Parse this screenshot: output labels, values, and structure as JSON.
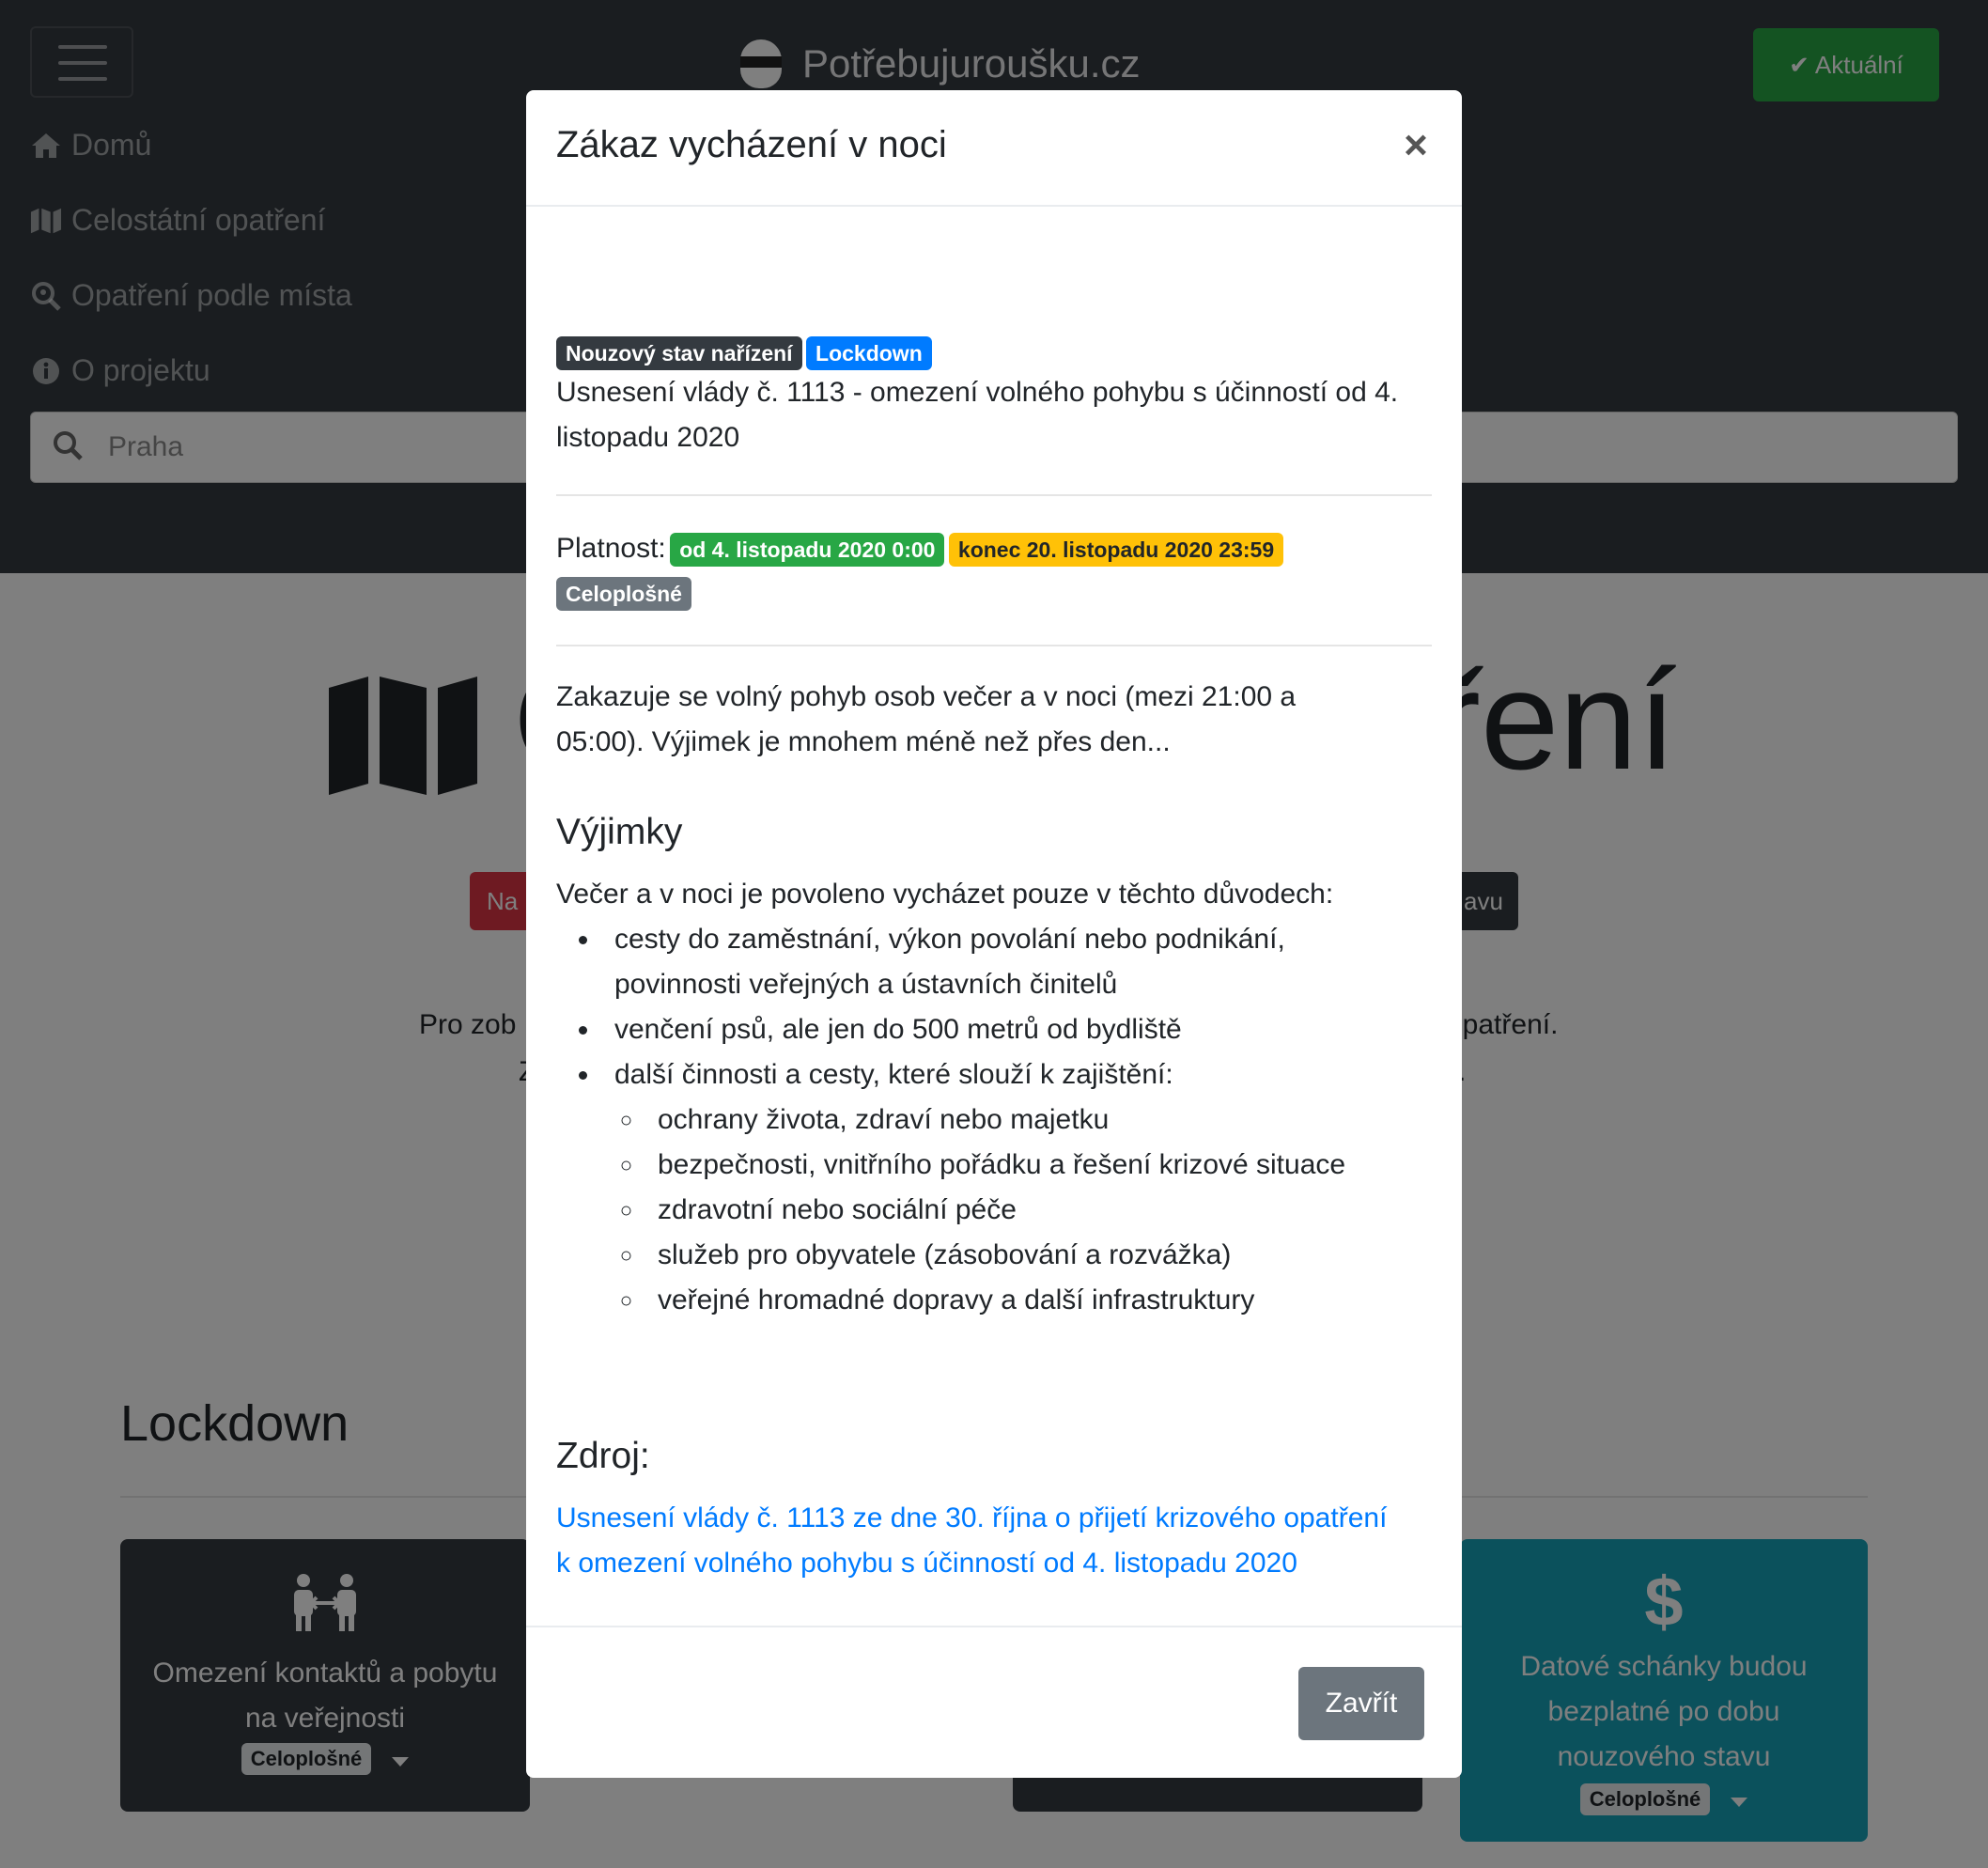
{
  "navbar": {
    "brand": "Potřebujuroušku.cz",
    "status_button": "Aktuální",
    "menu": [
      {
        "label": "Domů",
        "icon": "home-icon"
      },
      {
        "label": "Celostátní opatření",
        "icon": "map-icon"
      },
      {
        "label": "Opatření podle místa",
        "icon": "search-location-icon"
      },
      {
        "label": "O projektu",
        "icon": "info-circle-icon"
      }
    ],
    "search_placeholder": "Praha"
  },
  "background": {
    "heading_left": "C",
    "heading_right": "ření",
    "pill_left": "Na",
    "pill_right": "avu",
    "text_line1_left": "Pro zob",
    "text_line1_right": "opatření.",
    "text_line2_left": "Z",
    "text_line2_right": ".",
    "section_title": "Lockdown",
    "cards": [
      {
        "title": "Omezení kontaktů a pobytu na veřejnosti",
        "badge": "Celoplošné",
        "icon": "people-distance-icon"
      },
      {
        "title": "Datové schánky budou bezplatné po dobu nouzového stavu",
        "badge": "Celoplošné",
        "icon": "dollar-icon"
      }
    ]
  },
  "modal": {
    "title": "Zákaz vycházení v noci",
    "close_symbol": "×",
    "tags": [
      "Nouzový stav nařízení",
      "Lockdown"
    ],
    "summary": "Usnesení vlády č. 1113 - omezení volného pohybu s účinností od 4. listopadu 2020",
    "validity_label": "Platnost:",
    "valid_from": "od 4. listopadu 2020 0:00",
    "valid_to": "konec 20. listopadu 2020 23:59",
    "scope": "Celoplošné",
    "description": "Zakazuje se volný pohyb osob večer a v noci (mezi 21:00 a 05:00). Výjimek je mnohem méně než přes den...",
    "exceptions_heading": "Výjimky",
    "exceptions_intro": "Večer a v noci je povoleno vycházet pouze v těchto důvodech:",
    "exceptions": [
      "cesty do zaměstnání, výkon povolání nebo podnikání, povinnosti veřejných a ústavních činitelů",
      "venčení psů, ale jen do 500 metrů od bydliště",
      "další činnosti a cesty, které slouží k zajištění:"
    ],
    "sub_exceptions": [
      "ochrany života, zdraví nebo majetku",
      "bezpečnosti, vnitřního pořádku a řešení krizové situace",
      "zdravotní nebo sociální péče",
      "služeb pro obyvatele (zásobování a rozvážka)",
      "veřejné hromadné dopravy a další infrastruktury"
    ],
    "source_heading": "Zdroj:",
    "source_link": "Usnesení vlády č. 1113 ze dne 30. října o přijetí krizového opatření k omezení volného pohybu s účinností od 4. listopadu 2020",
    "close_button": "Zavřít"
  },
  "colors": {
    "navbar_bg": "#343a40",
    "success": "#28a745",
    "primary": "#007bff",
    "warning": "#ffc107",
    "secondary": "#6c757d",
    "danger": "#dc3545",
    "info_card": "#17a2b8"
  }
}
